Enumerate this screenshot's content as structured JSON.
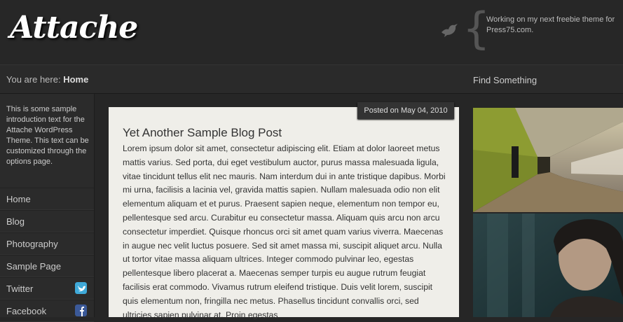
{
  "header": {
    "logo_text": "Attache",
    "tweet_text": "Working on my next freebie theme for Press75.com."
  },
  "breadcrumb": {
    "prefix": "You are here:",
    "current": "Home"
  },
  "search": {
    "label": "Find Something"
  },
  "sidebar": {
    "intro": "This is some sample introduction text for the Attache WordPress Theme. This text can be customized through the options page.",
    "nav": [
      {
        "label": "Home"
      },
      {
        "label": "Blog"
      },
      {
        "label": "Photography"
      },
      {
        "label": "Sample Page"
      },
      {
        "label": "Twitter",
        "icon": "twitter-icon"
      },
      {
        "label": "Facebook",
        "icon": "facebook-icon"
      }
    ]
  },
  "post": {
    "meta": "Posted on May 04, 2010",
    "title": "Yet Another Sample Blog Post",
    "body": "Lorem ipsum dolor sit amet, consectetur adipiscing elit. Etiam at dolor laoreet metus mattis varius. Sed porta, dui eget vestibulum auctor, purus massa malesuada ligula, vitae tincidunt tellus elit nec mauris. Nam interdum dui in ante tristique dapibus. Morbi mi urna, facilisis a lacinia vel, gravida mattis sapien. Nullam malesuada odio non elit elementum aliquam et et purus. Praesent sapien neque, elementum non tempor eu, pellentesque sed arcu. Curabitur eu consectetur massa. Aliquam quis arcu non arcu consectetur imperdiet. Quisque rhoncus orci sit amet quam varius viverra. Maecenas in augue nec velit luctus posuere. Sed sit amet massa mi, suscipit aliquet arcu. Nulla ut tortor vitae massa aliquam ultrices. Integer commodo pulvinar leo, egestas pellentesque libero placerat a. Maecenas semper turpis eu augue rutrum feugiat facilisis erat commodo. Vivamus rutrum eleifend tristique. Duis velit lorem, suscipit quis elementum non, fringilla nec metus. Phasellus tincidunt convallis orci, sed ultricies sapien pulvinar at. Proin egestas"
  },
  "colors": {
    "background": "#262626",
    "post_background": "#efeee9",
    "twitter": "#3fa9d8",
    "facebook": "#3b5998"
  }
}
